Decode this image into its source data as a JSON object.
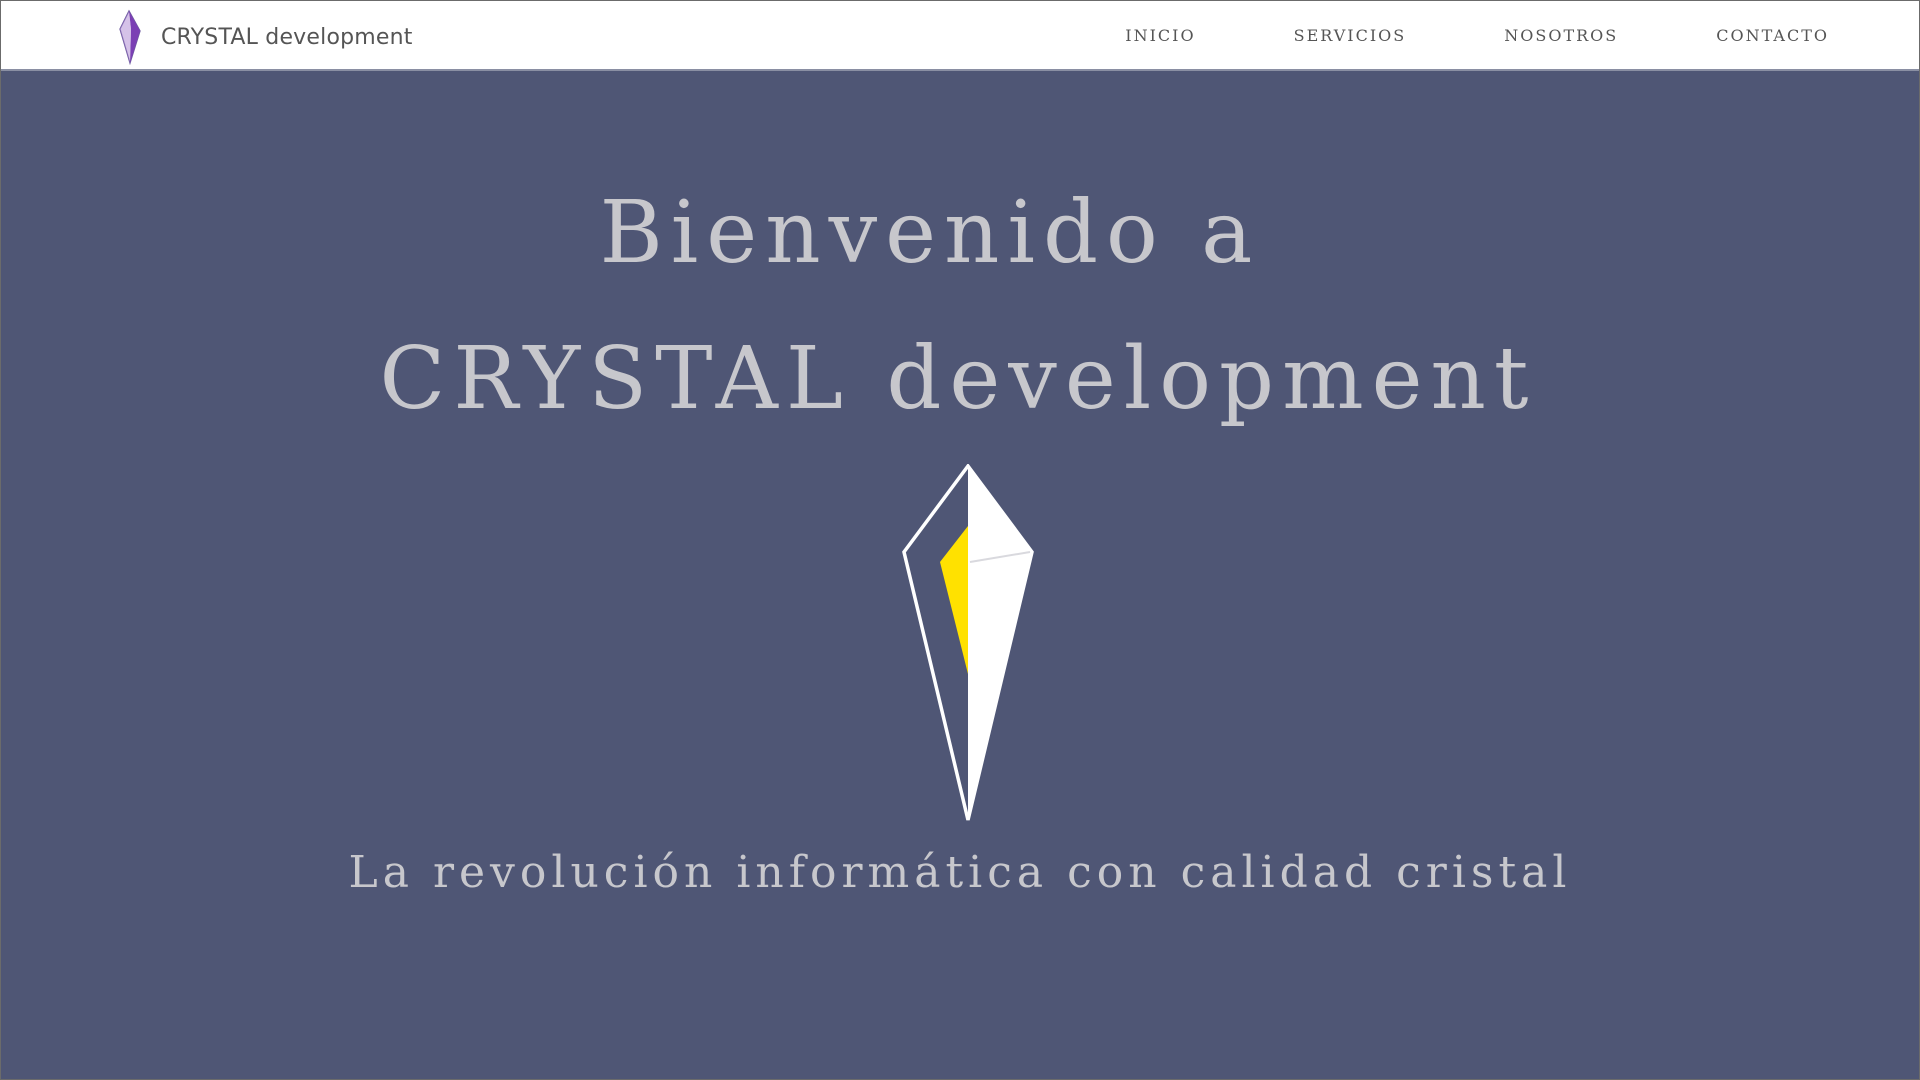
{
  "brand": {
    "name": "CRYSTAL development",
    "logo_icon": "crystal-logo-icon",
    "logo_color": "#7b3fb4"
  },
  "nav": {
    "items": [
      {
        "label": "INICIO"
      },
      {
        "label": "SERVICIOS"
      },
      {
        "label": "NOSOTROS"
      },
      {
        "label": "CONTACTO"
      }
    ]
  },
  "hero": {
    "title_line1": "Bienvenido a",
    "title_line2": "CRYSTAL development",
    "tagline": "La revolución informática con calidad cristal",
    "crystal_icon": "crystal-icon",
    "background_color": "#4f5675",
    "text_color": "#c7c7cc",
    "crystal_accent_color": "#ffe100"
  }
}
